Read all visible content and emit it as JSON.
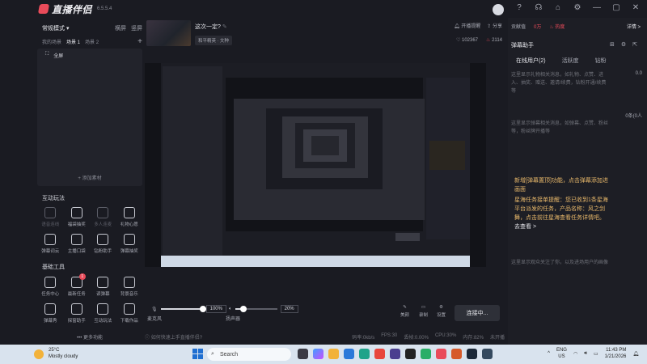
{
  "app": {
    "title": "直播伴侣",
    "version": "6.5.5.4"
  },
  "window_controls": [
    "help-icon",
    "headset-icon",
    "shirt-icon",
    "settings-icon",
    "minimize-icon",
    "maximize-icon",
    "close-icon"
  ],
  "left": {
    "mode": "常规模式",
    "mode_actions": [
      "横屏",
      "竖屏"
    ],
    "scene_prefix": "我的场景",
    "scenes": [
      "场景 1",
      "场景 2"
    ],
    "source_item": "全屏",
    "add_source": "+ 添加素材",
    "interactive_title": "互动玩法",
    "interactive_tools": [
      {
        "label": "语音连线",
        "icon": "mic-icon",
        "dim": true
      },
      {
        "label": "福袋抽奖",
        "icon": "shield-icon",
        "dim": false
      },
      {
        "label": "多人连麦",
        "icon": "people-icon",
        "dim": true
      },
      {
        "label": "礼物心愿",
        "icon": "gift-icon",
        "dim": false
      },
      {
        "label": "弹幕词云",
        "icon": "download-icon",
        "dim": false
      },
      {
        "label": "主播口袋",
        "icon": "pocket-icon",
        "dim": false
      },
      {
        "label": "钻粉助手",
        "icon": "diamond-icon",
        "dim": false
      },
      {
        "label": "弹幕抽奖",
        "icon": "lottery-icon",
        "dim": false
      }
    ],
    "basic_title": "基础工具",
    "basic_tools": [
      {
        "label": "任务中心",
        "icon": "task-icon",
        "badge": ""
      },
      {
        "label": "最新任务",
        "icon": "ai-icon",
        "badge": "1"
      },
      {
        "label": "读弹幕",
        "icon": "voice-icon",
        "badge": ""
      },
      {
        "label": "背景音乐",
        "icon": "music-download-icon",
        "badge": ""
      },
      {
        "label": "弹幕秀",
        "icon": "danmaku-icon",
        "badge": ""
      },
      {
        "label": "探窗助手",
        "icon": "window-icon",
        "badge": ""
      },
      {
        "label": "互动玩法",
        "icon": "record-icon",
        "badge": ""
      },
      {
        "label": "下载作品",
        "icon": "works-icon",
        "badge": ""
      }
    ],
    "more": "••• 更多功能"
  },
  "stream": {
    "title": "这次一定?",
    "tag": "和平精英 · 文种",
    "remind": "开播提醒",
    "share": "分享",
    "likes": "102367",
    "viewers": "2114"
  },
  "controls": {
    "mic_label": "麦克风",
    "mic_volume": "100%",
    "mic_level": 1.0,
    "speaker_label": "扬声器",
    "speaker_volume": "20%",
    "speaker_level": 0.2,
    "beauty": "美颜",
    "camera": "录制",
    "settings": "设置",
    "connect": "连接中..."
  },
  "status": {
    "hint": "如何快速上手直播伴侣?",
    "bitrate": "码率:0kb/s",
    "fps": "FPS:30",
    "drop": "丢帧:0.00%",
    "cpu": "CPU:30%",
    "mem": "内存:82%",
    "state": "未开播"
  },
  "right": {
    "contrib": "贡献值",
    "ranking": "0万",
    "hot": "热度",
    "detail": "详情 >",
    "title": "弹幕助手",
    "tabs": [
      "在线用户(2)",
      "活跃度",
      "钻粉"
    ],
    "hint1": "这里显示礼物相关消息，如礼物、点赞、进入、抽奖、赠送、邀请/续费，钻粉开通/续费等",
    "count1": "0.0",
    "hint2": "这里显示弹幕相关消息，如弹幕、点赞、粉丝等，粉丝牌开播等",
    "count2": "0条(0人",
    "notice_lines": [
      "新增[弹幕置顶]功能，点击弹幕添加进画面",
      "星海任务接单提醒：您已收到1条星海平台派发的任务，产品名称：风之剑舞，点击前往星海查看任务详情吧。"
    ],
    "notice_go": "去查看 >",
    "hint3": "这里显示观众关注了你，以及进场用户的画像"
  },
  "taskbar": {
    "temp": "25°C",
    "weather": "Mostly cloudy",
    "search": "Search",
    "lang": "ENG",
    "region": "US",
    "time": "11:43 PM",
    "date": "1/21/2026"
  }
}
